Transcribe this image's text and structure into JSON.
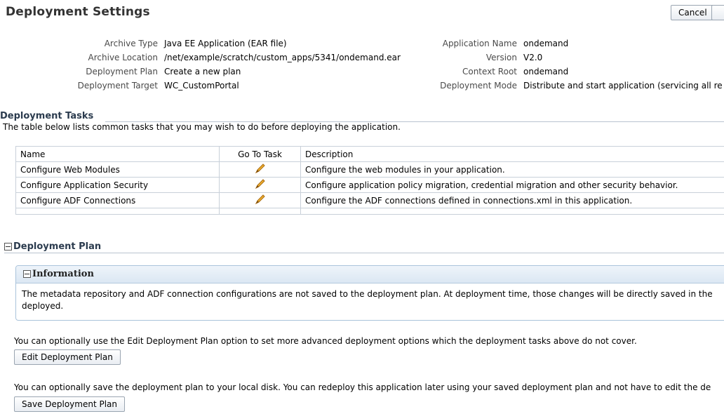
{
  "header": {
    "title": "Deployment Settings",
    "cancel_label": "Cancel",
    "next_label": ""
  },
  "properties_left": [
    {
      "label": "Archive Type",
      "value": "Java EE Application (EAR file)"
    },
    {
      "label": "Archive Location",
      "value": "/net/example/scratch/custom_apps/5341/ondemand.ear"
    },
    {
      "label": "Deployment Plan",
      "value": "Create a new plan"
    },
    {
      "label": "Deployment Target",
      "value": "WC_CustomPortal"
    }
  ],
  "properties_right": [
    {
      "label": "Application Name",
      "value": "ondemand"
    },
    {
      "label": "Version",
      "value": "V2.0"
    },
    {
      "label": "Context Root",
      "value": "ondemand"
    },
    {
      "label": "Deployment Mode",
      "value": "Distribute and start application (servicing all re"
    }
  ],
  "tasks": {
    "title": "Deployment Tasks",
    "description": "The table below lists common tasks that you may wish to do before deploying the application.",
    "columns": [
      "Name",
      "Go To Task",
      "Description"
    ],
    "rows": [
      {
        "name": "Configure Web Modules",
        "icon": "pencil-icon",
        "description": "Configure the web modules in your application."
      },
      {
        "name": "Configure Application Security",
        "icon": "pencil-icon",
        "description": "Configure application policy migration, credential migration and other security behavior."
      },
      {
        "name": "Configure ADF Connections",
        "icon": "pencil-icon",
        "description": "Configure the ADF connections defined in connections.xml in this application."
      }
    ]
  },
  "plan": {
    "title": "Deployment Plan",
    "info_title": "Information",
    "info_text": "The metadata repository and ADF connection configurations are not saved to the deployment plan. At deployment time, those changes will be directly saved in the deployed.",
    "edit_text": "You can optionally use the Edit Deployment Plan option to set more advanced deployment options which the deployment tasks above do not cover.",
    "edit_button": "Edit Deployment Plan",
    "save_text": "You can optionally save the deployment plan to your local disk. You can redeploy this application later using your saved deployment plan and not have to edit the de",
    "save_button": "Save Deployment Plan"
  },
  "colors": {
    "section_header": "#2b3b4e",
    "info_header": "#dbe7f3",
    "pencil": "#d9901a"
  }
}
